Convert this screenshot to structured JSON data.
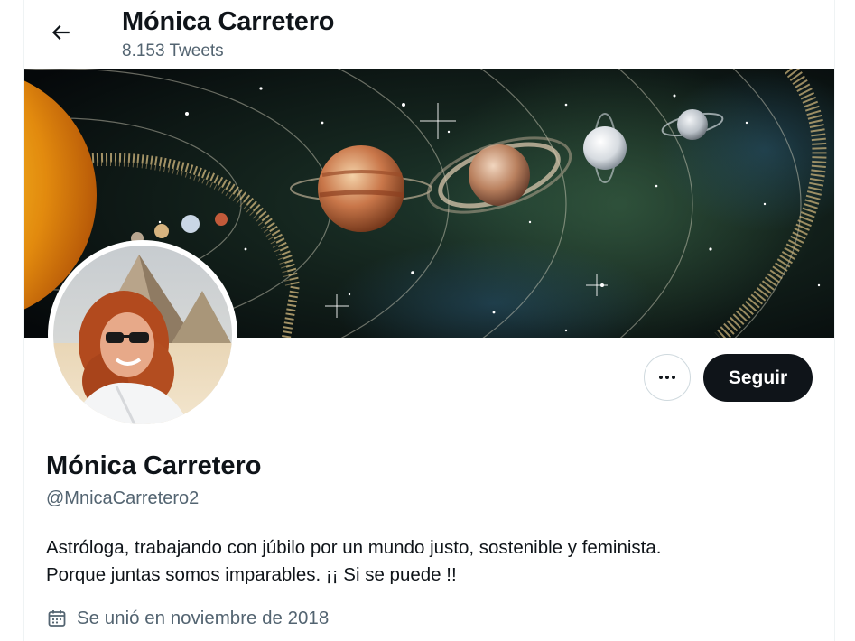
{
  "header": {
    "title": "Mónica Carretero",
    "subtitle": "8.153 Tweets",
    "back_icon": "arrow-left-icon"
  },
  "profile": {
    "display_name": "Mónica Carretero",
    "handle": "@MnicaCarretero2",
    "bio_lines": [
      "Astróloga, trabajando con júbilo por un mundo justo, sostenible y feminista.",
      "Porque juntas somos imparables. ¡¡ Si se puede !!"
    ],
    "joined": "Se unió en noviembre de 2018",
    "joined_icon": "calendar-icon"
  },
  "actions": {
    "more_icon": "more-horizontal-icon",
    "follow_label": "Seguir"
  },
  "colors": {
    "text_primary": "#0f1419",
    "text_secondary": "#536471",
    "button_dark": "#0f1419",
    "border": "#cfd9de"
  }
}
